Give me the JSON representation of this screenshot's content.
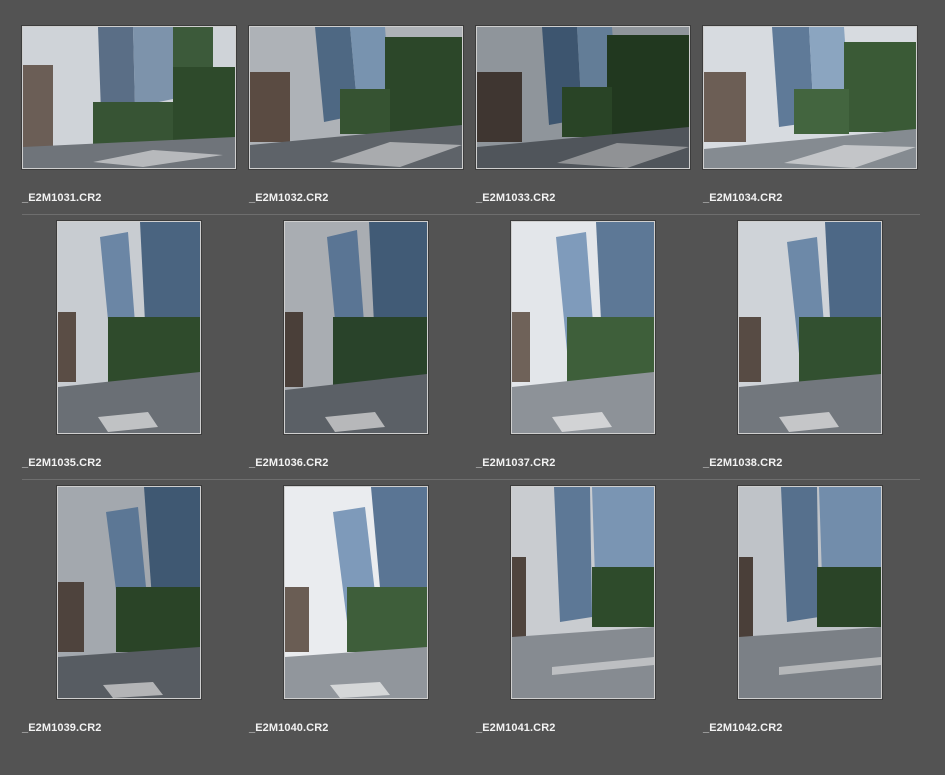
{
  "browser": {
    "items": [
      {
        "filename": "_E2M1031.CR2",
        "orientation": "landscape"
      },
      {
        "filename": "_E2M1032.CR2",
        "orientation": "landscape"
      },
      {
        "filename": "_E2M1033.CR2",
        "orientation": "landscape"
      },
      {
        "filename": "_E2M1034.CR2",
        "orientation": "landscape"
      },
      {
        "filename": "_E2M1035.CR2",
        "orientation": "portrait"
      },
      {
        "filename": "_E2M1036.CR2",
        "orientation": "portrait"
      },
      {
        "filename": "_E2M1037.CR2",
        "orientation": "portrait"
      },
      {
        "filename": "_E2M1038.CR2",
        "orientation": "portrait"
      },
      {
        "filename": "_E2M1039.CR2",
        "orientation": "portrait"
      },
      {
        "filename": "_E2M1040.CR2",
        "orientation": "portrait"
      },
      {
        "filename": "_E2M1041.CR2",
        "orientation": "portrait"
      },
      {
        "filename": "_E2M1042.CR2",
        "orientation": "portrait"
      }
    ]
  },
  "colors": {
    "background": "#535353",
    "label_text": "#f2f2f2",
    "thumb_border": "#cfcfcf",
    "divider": "#6e6e6e"
  }
}
